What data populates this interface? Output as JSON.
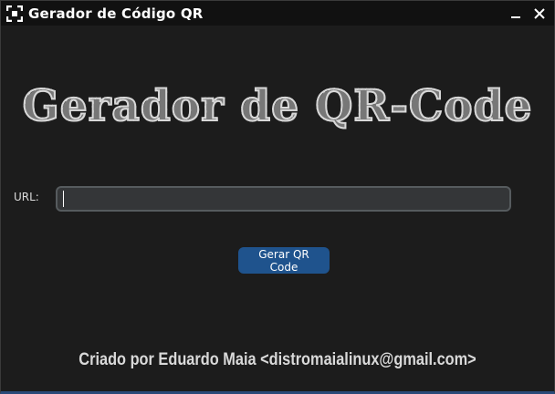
{
  "window": {
    "title": "Gerador de Código QR",
    "icon": "qr-frame-icon",
    "controls": {
      "minimize_icon": "minimize-icon",
      "close_icon": "close-icon"
    }
  },
  "header": {
    "banner_text": "Gerador de QR-Code"
  },
  "form": {
    "url_label": "URL:",
    "url_value": "",
    "generate_button_label": "Gerar QR Code"
  },
  "footer": {
    "credit": "Criado por Eduardo Maia <distromaialinux@gmail.com>"
  },
  "colors": {
    "window_bg": "#1c1c1c",
    "titlebar_bg": "#111111",
    "input_bg": "#343638",
    "input_border": "#565b5e",
    "button_bg": "#1f538d",
    "text": "#dcdcdc"
  }
}
